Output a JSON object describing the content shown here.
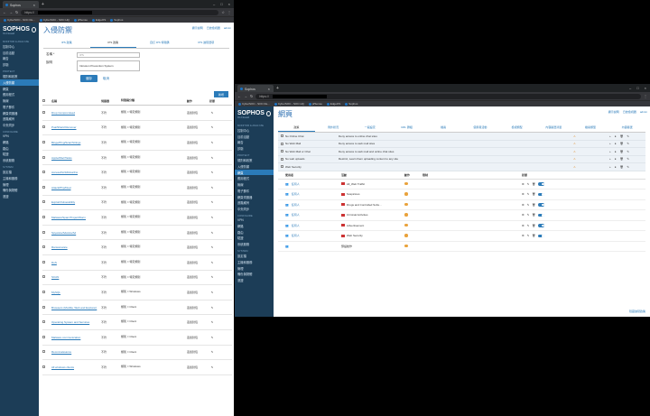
{
  "w1": {
    "tab": "Sophos",
    "url": "https://",
    "bookmarks": [
      "CyberSOC - SOC Re...",
      "CyberSOC - SOC HQ",
      "pfSense",
      "EdgeOS",
      "Sophos"
    ],
    "title": "入侵防禦",
    "links": [
      "顯示說明",
      "日誌檢視器",
      "admin"
    ],
    "tabs": [
      "IPS 政策",
      "IPS 政策",
      "自訂 IPS 特徵碼",
      "IPS 進階選項"
    ],
    "form": {
      "name_label": "名稱 *",
      "name_ph": "IPS",
      "desc_label": "說明",
      "desc_val": "Intrusion Prevention System",
      "save": "儲存",
      "cancel": "取消"
    },
    "add": "新增",
    "cols": [
      "名稱",
      "伺服器",
      "特徵碼分類",
      "動作",
      "狀態"
    ],
    "rows": [
      {
        "n": "Drop Compromised",
        "s": "不符",
        "d": "類別 = 特定類別",
        "a": "丟棄封包"
      },
      {
        "n": "Pua/Shield Remover",
        "s": "不符",
        "d": "類別 = 特定類別",
        "a": "丟棄封包"
      },
      {
        "n": "Binge/Ping/Scan/Strings",
        "s": "不符",
        "d": "類別 = 特定類別",
        "a": "丟棄封包"
      },
      {
        "n": "Apple/Mac/Tasks",
        "s": "不符",
        "d": "類別 = 特定類別",
        "a": "丟棄封包"
      },
      {
        "n": "Access/DoS/Ddos/Fw",
        "s": "不符",
        "d": "類別 = 特定類別",
        "a": "丟棄封包"
      },
      {
        "n": "Attack/Php/Dual",
        "s": "不符",
        "d": "類別 = 特定類別",
        "a": "丟棄封包"
      },
      {
        "n": "Exploit/Vulnerability",
        "s": "不符",
        "d": "類別 = 特定類別",
        "a": "丟棄封包"
      },
      {
        "n": "Malware/Spam/Trojan/Worm",
        "s": "不符",
        "d": "類別 = 特定類別",
        "a": "丟棄封包"
      },
      {
        "n": "Spyware/Adware/Ad",
        "s": "不符",
        "d": "類別 = 特定類別",
        "a": "丟棄封包"
      },
      {
        "n": "Ransomware",
        "s": "不符",
        "d": "類別 = 特定類別",
        "a": "丟棄封包"
      },
      {
        "n": "DoS",
        "s": "不符",
        "d": "類別 = 特定類別",
        "a": "丟棄封包"
      },
      {
        "n": "SCAN",
        "s": "不符",
        "d": "類別 = 特定類別",
        "a": "丟棄封包"
      },
      {
        "n": "MySQL",
        "s": "不符",
        "d": "類別 = Windows",
        "a": "丟棄封包"
      },
      {
        "n": "Browsers (Mozilla, Web and Explorer)",
        "s": "不符",
        "d": "類別 = Client",
        "a": "丟棄封包"
      },
      {
        "n": "Operating System and Services",
        "s": "不符",
        "d": "類別 = Client",
        "a": "丟棄封包"
      },
      {
        "n": "Malware communication",
        "s": "不符",
        "d": "類別 = Client",
        "a": "丟棄封包"
      },
      {
        "n": "Reconnaissance",
        "s": "不符",
        "d": "類別 = Client",
        "a": "丟棄封包"
      },
      {
        "n": "All windows clients",
        "s": "不符",
        "d": "類別 = Windows",
        "a": "丟棄封包"
      }
    ]
  },
  "w2": {
    "tab": "Sophos",
    "title": "網頁",
    "tabs": [
      "政策",
      "例外狀況",
      "一般設定",
      "URL 群組",
      "檔案",
      "使用者活動",
      "檢視類型",
      "內容篩選清單",
      "檔案類型",
      "內容篩選"
    ],
    "prows": [
      {
        "n": "No Online Chat",
        "d": "Deny access to online chat sites"
      },
      {
        "n": "No Web Mail",
        "d": "Deny access to web mail sites"
      },
      {
        "n": "No Web Mail or Chat",
        "d": "Deny access to web mail and online chat sites"
      },
      {
        "n": "No web uploads",
        "d": "Restrict, Learn them uploading content to any site"
      },
      {
        "n": "Web Security",
        "d": ""
      }
    ],
    "scols": [
      "使用者",
      "活動",
      "動作",
      "限制",
      "狀態"
    ],
    "srows": [
      {
        "u": "任何人",
        "a": "All_Web Traffic"
      },
      {
        "u": "任何人",
        "a": "Suspicious"
      },
      {
        "u": "任何人",
        "a": "Drugs and Controlled Subs..."
      },
      {
        "u": "任何人",
        "a": "Criminal Activities"
      },
      {
        "u": "任何人",
        "a": "Advertisement"
      },
      {
        "u": "任何人",
        "a": "Web Security"
      },
      {
        "u": "",
        "a": "預設動作"
      }
    ],
    "more": "隱藏進階政策"
  },
  "side": {
    "sections": [
      {
        "h": "MONITOR & ANALYZE",
        "items": [
          "控制中心",
          "目前活動",
          "報告",
          "診斷"
        ]
      },
      {
        "h": "PROTECT",
        "items": [
          "規則和政策",
          "入侵防禦",
          "網頁",
          "應用程式",
          "無線",
          "電子郵件",
          "網頁伺服器",
          "進階威脅",
          "中央同步"
        ]
      },
      {
        "h": "CONFIGURE",
        "items": [
          "VPN",
          "網路",
          "路由",
          "驗證",
          "系統服務"
        ]
      },
      {
        "h": "SYSTEM",
        "items": [
          "設定檔",
          "主機和服務",
          "管理",
          "備份與韌體",
          "憑證"
        ]
      }
    ]
  }
}
